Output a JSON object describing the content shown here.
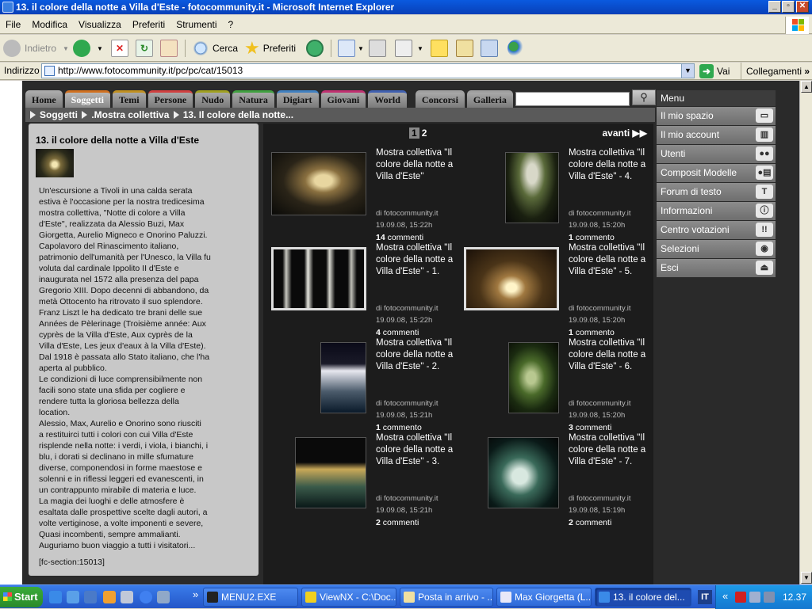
{
  "window": {
    "title": "13. il colore della notte a Villa d'Este - fotocommunity.it - Microsoft Internet Explorer",
    "minimize": "_",
    "maximize": "▫",
    "close": "✕"
  },
  "menubar": [
    "File",
    "Modifica",
    "Visualizza",
    "Preferiti",
    "Strumenti",
    "?"
  ],
  "toolbar": {
    "back": "Indietro",
    "search": "Cerca",
    "favorites": "Preferiti"
  },
  "address": {
    "label": "Indirizzo",
    "url": "http://www.fotocommunity.it/pc/pc/cat/15013",
    "go": "Vai",
    "links": "Collegamenti"
  },
  "site": {
    "tabs": [
      "Home",
      "Soggetti",
      "Temi",
      "Persone",
      "Nudo",
      "Natura",
      "Digiart",
      "Giovani",
      "World",
      "Concorsi",
      "Galleria"
    ],
    "active_tab": "Soggetti",
    "breadcrumb": [
      "Soggetti",
      ".Mostra collettiva",
      "13. Il colore della notte..."
    ],
    "left": {
      "title": "13. il colore della notte a Villa d'Este",
      "description": "Un'escursione a Tivoli in una calda serata\nestiva è l'occasione per la nostra tredicesima\nmostra collettiva, \"Notte di colore a Villa\nd'Este\", realizzata da Alessio Buzi, Max\nGiorgetta, Aurelio Migneco e Onorino Paluzzi.\nCapolavoro del Rinascimento italiano,\npatrimonio dell'umanità per l'Unesco, la Villa fu\nvoluta dal cardinale Ippolito II d'Este e\ninaugurata nel 1572 alla presenza del papa\nGregorio XIII. Dopo decenni di abbandono, da\nmetà Ottocento ha ritrovato il suo splendore.\nFranz Liszt le ha dedicato tre brani delle sue\nAnnées de Pèlerinage (Troisième année: Aux\ncyprès de la Villa d'Este, Aux cyprès de la\nVilla d'Este, Les jeux d'eaux à la Villa d'Este).\nDal 1918 è passata allo Stato italiano, che l'ha\naperta al pubblico.\nLe condizioni di luce comprensibilmente non\nfacili sono state una sfida per cogliere e\nrendere tutta la gloriosa bellezza della\nlocation.\nAlessio, Max, Aurelio e Onorino sono riusciti\na restituirci tutti i colori con cui Villa d'Este\nrisplende nella notte: i verdi, i viola, i bianchi, i\nblu, i dorati si declinano in mille sfumature\ndiverse, componendosi in forme maestose e\nsolenni e in riflessi leggeri ed evanescenti, in\nun contrappunto mirabile di materia e luce.\nLa magia dei luoghi e delle atmosfere è\nesaltata dalle prospettive scelte dagli autori, a\nvolte vertiginose, a volte imponenti e severe,\nQuasi incombenti, sempre ammalianti.\nAuguriamo buon viaggio a tutti i visitatori...",
      "section": "[fc-section:15013]"
    },
    "pager": {
      "current": "1",
      "next_page": "2",
      "next_label": "avanti"
    },
    "photos": [
      {
        "title": "Mostra collettiva \"Il colore della notte a Villa d'Este\"",
        "by": "di fotocommunity.it",
        "date": "19.09.08, 15:22h",
        "comments_count": "14",
        "comments_label": " commenti"
      },
      {
        "title": "Mostra collettiva \"Il colore della notte a Villa d'Este\" - 4.",
        "by": "di fotocommunity.it",
        "date": "19.09.08, 15:20h",
        "comments_count": "1",
        "comments_label": " commento"
      },
      {
        "title": "Mostra collettiva \"Il colore della notte a Villa d'Este\" - 1.",
        "by": "di fotocommunity.it",
        "date": "19.09.08, 15:22h",
        "comments_count": "4",
        "comments_label": " commenti"
      },
      {
        "title": "Mostra collettiva \"Il colore della notte a Villa d'Este\" - 5.",
        "by": "di fotocommunity.it",
        "date": "19.09.08, 15:20h",
        "comments_count": "1",
        "comments_label": " commento"
      },
      {
        "title": "Mostra collettiva \"Il colore della notte a Villa d'Este\" - 2.",
        "by": "di fotocommunity.it",
        "date": "19.09.08, 15:21h",
        "comments_count": "1",
        "comments_label": " commento"
      },
      {
        "title": "Mostra collettiva \"Il colore della notte a Villa d'Este\" - 6.",
        "by": "di fotocommunity.it",
        "date": "19.09.08, 15:20h",
        "comments_count": "3",
        "comments_label": " commenti"
      },
      {
        "title": "Mostra collettiva \"Il colore della notte a Villa d'Este\" - 3.",
        "by": "di fotocommunity.it",
        "date": "19.09.08, 15:21h",
        "comments_count": "2",
        "comments_label": " commenti"
      },
      {
        "title": "Mostra collettiva \"Il colore della notte a Villa d'Este\" - 7.",
        "by": "di fotocommunity.it",
        "date": "19.09.08, 15:19h",
        "comments_count": "2",
        "comments_label": " commenti"
      }
    ],
    "menu": {
      "header": "Menu",
      "items": [
        {
          "label": "Il mio spazio",
          "icon": "folder-icon"
        },
        {
          "label": "Il mio account",
          "icon": "cabinet-icon"
        },
        {
          "label": "Utenti",
          "icon": "users-icon"
        },
        {
          "label": "Composit Modelle",
          "icon": "model-card-icon"
        },
        {
          "label": "Forum di testo",
          "icon": "text-icon"
        },
        {
          "label": "Informazioni",
          "icon": "info-icon"
        },
        {
          "label": "Centro votazioni",
          "icon": "exclamation-icon"
        },
        {
          "label": "Selezioni",
          "icon": "eye-icon"
        },
        {
          "label": "Esci",
          "icon": "eject-icon"
        }
      ]
    }
  },
  "taskbar": {
    "start": "Start",
    "tasks": [
      "MENU2.EXE",
      "ViewNX - C:\\Doc...",
      "Posta in arrivo - ...",
      "Max Giorgetta (L...",
      "13. il colore del..."
    ],
    "lang": "IT",
    "clock": "12.37",
    "collapse": "«"
  }
}
